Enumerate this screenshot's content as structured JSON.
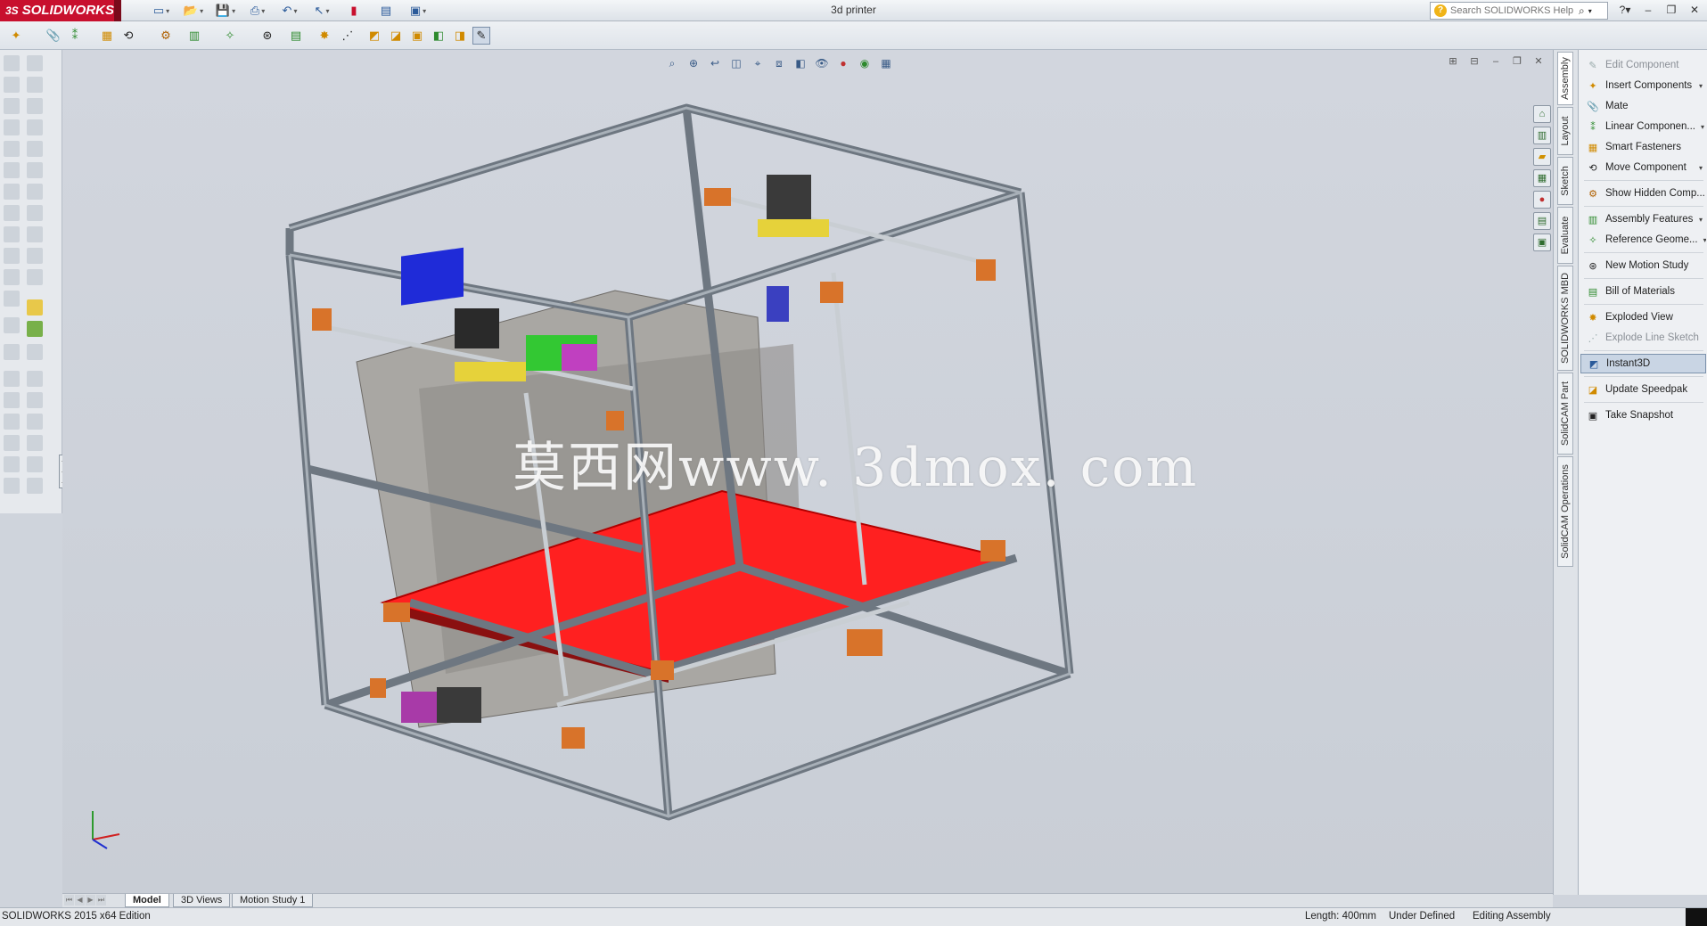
{
  "app": {
    "brand": "SOLIDWORKS",
    "document_title": "3d printer",
    "help_search_placeholder": "Search SOLIDWORKS Help"
  },
  "task_pane_tabs": [
    "Assembly",
    "Layout",
    "Sketch",
    "Evaluate",
    "SOLIDWORKS MBD",
    "SolidCAM Part",
    "SolidCAM Operations"
  ],
  "command_manager": [
    {
      "label": "Edit Component",
      "icon": "edit-component-icon",
      "disabled": true,
      "dropdown": false
    },
    {
      "label": "Insert Components",
      "icon": "insert-components-icon",
      "disabled": false,
      "dropdown": true
    },
    {
      "label": "Mate",
      "icon": "mate-icon",
      "disabled": false,
      "dropdown": false
    },
    {
      "label": "Linear Componen...",
      "icon": "linear-pattern-icon",
      "disabled": false,
      "dropdown": true
    },
    {
      "label": "Smart Fasteners",
      "icon": "smart-fasteners-icon",
      "disabled": false,
      "dropdown": false
    },
    {
      "label": "Move Component",
      "icon": "move-component-icon",
      "disabled": false,
      "dropdown": true
    },
    {
      "label": "Show Hidden Comp...",
      "icon": "show-hidden-icon",
      "disabled": false,
      "dropdown": false
    },
    {
      "label": "Assembly Features",
      "icon": "assembly-features-icon",
      "disabled": false,
      "dropdown": true
    },
    {
      "label": "Reference Geome...",
      "icon": "reference-geometry-icon",
      "disabled": false,
      "dropdown": true
    },
    {
      "label": "New Motion Study",
      "icon": "motion-study-icon",
      "disabled": false,
      "dropdown": false
    },
    {
      "label": "Bill of Materials",
      "icon": "bill-of-materials-icon",
      "disabled": false,
      "dropdown": false
    },
    {
      "label": "Exploded View",
      "icon": "exploded-view-icon",
      "disabled": false,
      "dropdown": false
    },
    {
      "label": "Explode Line Sketch",
      "icon": "explode-line-sketch-icon",
      "disabled": true,
      "dropdown": false
    },
    {
      "label": "Instant3D",
      "icon": "instant3d-icon",
      "disabled": false,
      "dropdown": false,
      "selected": true
    },
    {
      "label": "Update Speedpak",
      "icon": "speedpak-icon",
      "disabled": false,
      "dropdown": false
    },
    {
      "label": "Take Snapshot",
      "icon": "snapshot-icon",
      "disabled": false,
      "dropdown": false
    }
  ],
  "bottom_tabs": [
    "Model",
    "3D Views",
    "Motion Study 1"
  ],
  "active_bottom_tab": "Model",
  "status": {
    "edition": "SOLIDWORKS 2015 x64 Edition",
    "length": "Length: 400mm",
    "definition": "Under Defined",
    "mode": "Editing Assembly"
  },
  "viewport": {
    "watermark": "莫西网www. 3dmox. com"
  },
  "colors": {
    "brand_red": "#c8102e",
    "bed_red": "#ff2020",
    "bracket_orange": "#d8732a",
    "frame_gray": "#7d8690"
  }
}
